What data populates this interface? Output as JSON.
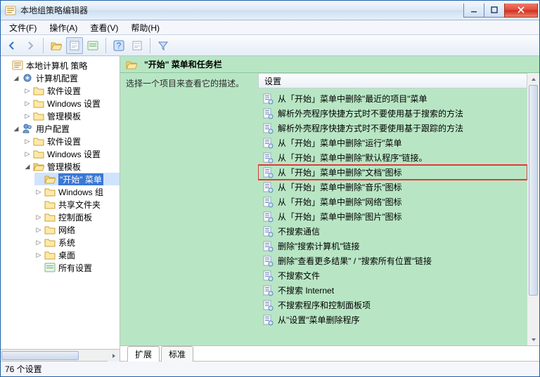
{
  "window": {
    "title": "本地组策略编辑器"
  },
  "menu": {
    "file": "文件(F)",
    "action": "操作(A)",
    "view": "查看(V)",
    "help": "帮助(H)"
  },
  "tree": {
    "root": "本地计算机 策略",
    "computer": "计算机配置",
    "comp_soft": "软件设置",
    "comp_win": "Windows 设置",
    "comp_admin": "管理模板",
    "user": "用户配置",
    "user_soft": "软件设置",
    "user_win": "Windows 设置",
    "user_admin": "管理模板",
    "start_menu": "\"开始\" 菜单",
    "win_comp": "Windows 组",
    "shared": "共享文件夹",
    "cpl": "控制面板",
    "network": "网络",
    "system": "系统",
    "desktop": "桌面",
    "all": "所有设置"
  },
  "details": {
    "heading": "\"开始\" 菜单和任务栏",
    "prompt": "选择一个项目来查看它的描述。",
    "col_header": "设置",
    "items": [
      "从「开始」菜单中删除\"最近的项目\"菜单",
      "解析外壳程序快捷方式时不要使用基于搜索的方法",
      "解析外壳程序快捷方式时不要使用基于跟踪的方法",
      "从「开始」菜单中删除\"运行\"菜单",
      "从「开始」菜单中删除\"默认程序\"链接。",
      "从「开始」菜单中删除\"文档\"图标",
      "从「开始」菜单中删除\"音乐\"图标",
      "从「开始」菜单中删除\"网络\"图标",
      "从「开始」菜单中删除\"图片\"图标",
      "不搜索通信",
      "删除\"搜索计算机\"链接",
      "删除\"查看更多结果\" / \"搜索所有位置\"链接",
      "不搜索文件",
      "不搜索 Internet",
      "不搜索程序和控制面板项",
      "从\"设置\"菜单删除程序"
    ],
    "highlight_index": 5
  },
  "tabs": {
    "extended": "扩展",
    "standard": "标准"
  },
  "status": "76 个设置"
}
